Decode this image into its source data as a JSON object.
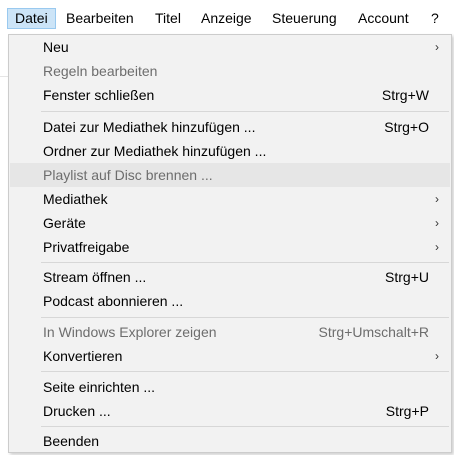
{
  "menubar": {
    "items": [
      {
        "label": "Datei"
      },
      {
        "label": "Bearbeiten"
      },
      {
        "label": "Titel"
      },
      {
        "label": "Anzeige"
      },
      {
        "label": "Steuerung"
      },
      {
        "label": "Account"
      },
      {
        "label": "?"
      }
    ]
  },
  "menu": {
    "items": [
      {
        "label": "Neu",
        "shortcut": "",
        "submenu": true,
        "disabled": false
      },
      {
        "label": "Regeln bearbeiten",
        "shortcut": "",
        "submenu": false,
        "disabled": true
      },
      {
        "label": "Fenster schließen",
        "shortcut": "Strg+W",
        "submenu": false,
        "disabled": false
      },
      {
        "label": "Datei zur Mediathek hinzufügen ...",
        "shortcut": "Strg+O",
        "submenu": false,
        "disabled": false
      },
      {
        "label": "Ordner zur Mediathek hinzufügen ...",
        "shortcut": "",
        "submenu": false,
        "disabled": false
      },
      {
        "label": "Playlist auf Disc brennen ...",
        "shortcut": "",
        "submenu": false,
        "disabled": true
      },
      {
        "label": "Mediathek",
        "shortcut": "",
        "submenu": true,
        "disabled": false
      },
      {
        "label": "Geräte",
        "shortcut": "",
        "submenu": true,
        "disabled": false
      },
      {
        "label": "Privatfreigabe",
        "shortcut": "",
        "submenu": true,
        "disabled": false
      },
      {
        "label": "Stream öffnen ...",
        "shortcut": "Strg+U",
        "submenu": false,
        "disabled": false
      },
      {
        "label": "Podcast abonnieren ...",
        "shortcut": "",
        "submenu": false,
        "disabled": false
      },
      {
        "label": "In Windows Explorer zeigen",
        "shortcut": "Strg+Umschalt+R",
        "submenu": false,
        "disabled": true
      },
      {
        "label": "Konvertieren",
        "shortcut": "",
        "submenu": true,
        "disabled": false
      },
      {
        "label": "Seite einrichten ...",
        "shortcut": "",
        "submenu": false,
        "disabled": false
      },
      {
        "label": "Drucken ...",
        "shortcut": "Strg+P",
        "submenu": false,
        "disabled": false
      },
      {
        "label": "Beenden",
        "shortcut": "",
        "submenu": false,
        "disabled": false
      }
    ],
    "submenu_arrow": "›"
  },
  "colors": {
    "menubar_active_bg": "#cce4f7",
    "menubar_active_border": "#99c9ef",
    "dropdown_bg": "#f2f2f2",
    "hover_bg": "#e6e6e6",
    "disabled_text": "#6d6d6d"
  }
}
